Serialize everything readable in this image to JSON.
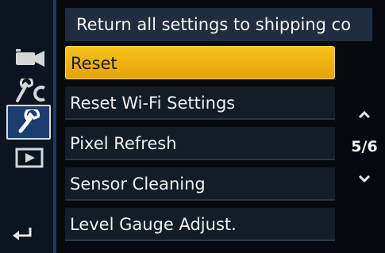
{
  "header": {
    "title": "Return all settings to shipping co"
  },
  "menu": {
    "items": [
      {
        "label": "Reset"
      },
      {
        "label": "Reset Wi-Fi Settings"
      },
      {
        "label": "Pixel Refresh"
      },
      {
        "label": "Sensor Cleaning"
      },
      {
        "label": "Level Gauge Adjust."
      }
    ]
  },
  "pagination": {
    "page_text": "5/6"
  },
  "sidebar": {
    "icons": [
      "movie-camera-icon",
      "custom-wrench-icon",
      "setup-wrench-icon",
      "playback-icon"
    ],
    "back_icon": "return-icon"
  },
  "colors": {
    "selected_highlight": "#f5b913",
    "active_tab": "#1b3d70",
    "header_bg": "#1f2d3f"
  }
}
